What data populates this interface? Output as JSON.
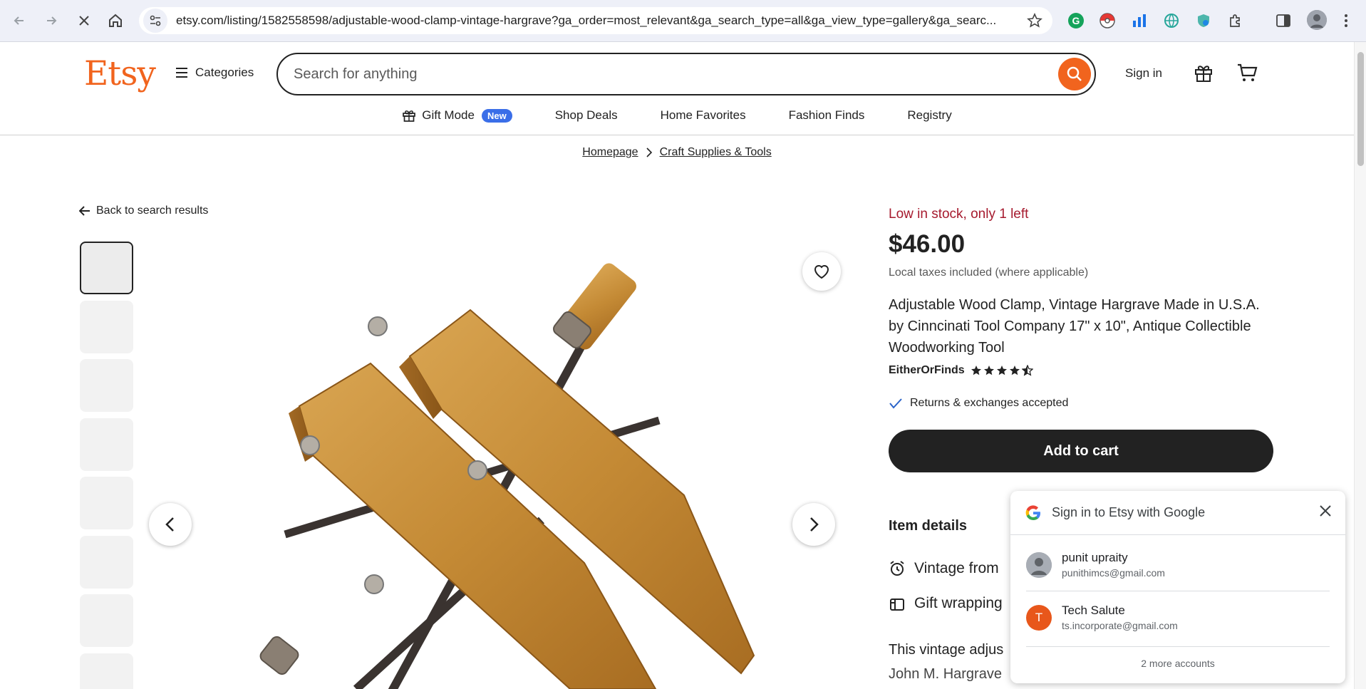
{
  "browser": {
    "url": "etsy.com/listing/1582558598/adjustable-wood-clamp-vintage-hargrave?ga_order=most_relevant&ga_search_type=all&ga_view_type=gallery&ga_searc..."
  },
  "header": {
    "logo": "Etsy",
    "categories_label": "Categories",
    "search_placeholder": "Search for anything",
    "signin_label": "Sign in"
  },
  "subnav": {
    "items": [
      {
        "label": "Gift Mode",
        "badge": "New"
      },
      {
        "label": "Shop Deals"
      },
      {
        "label": "Home Favorites"
      },
      {
        "label": "Fashion Finds"
      },
      {
        "label": "Registry"
      }
    ]
  },
  "breadcrumb": [
    "Homepage",
    "Craft Supplies & Tools"
  ],
  "back_link": "Back to search results",
  "product": {
    "stock": "Low in stock, only 1 left",
    "price": "$46.00",
    "taxes": "Local taxes included (where applicable)",
    "title": "Adjustable Wood Clamp, Vintage Hargrave Made in U.S.A. by Cinncinati Tool Company 17\" x 10\", Antique Collectible Woodworking Tool",
    "shop_name": "EitherOrFinds",
    "rating": 4.5,
    "returns": "Returns & exchanges accepted",
    "add_to_cart": "Add to cart",
    "item_details_title": "Item details",
    "detail_vintage": "Vintage from",
    "detail_gift": "Gift wrapping",
    "desc_line1": "This vintage adjus",
    "desc_line2": "John M. Hargrave"
  },
  "google_popup": {
    "title": "Sign in to Etsy with Google",
    "accounts": [
      {
        "name": "punit upraity",
        "email": "punithimcs@gmail.com"
      },
      {
        "name": "Tech Salute",
        "email": "ts.incorporate@gmail.com",
        "initial": "T"
      }
    ],
    "more": "2 more accounts"
  },
  "colors": {
    "brand": "#f1641e",
    "stock_red": "#a61a2e",
    "badge_blue": "#3a6ee8"
  }
}
